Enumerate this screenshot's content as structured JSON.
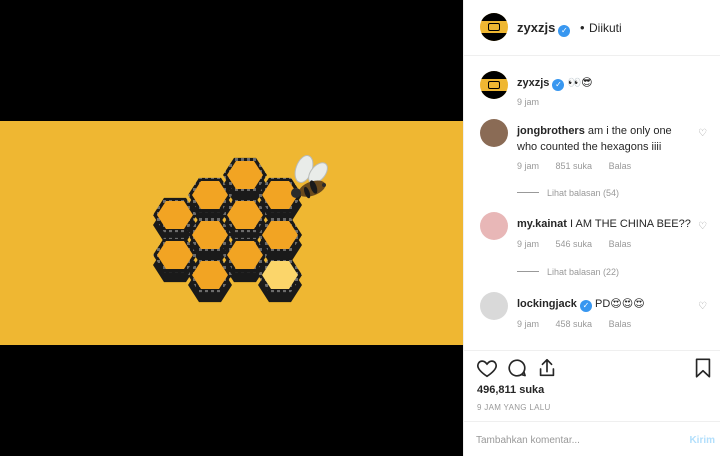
{
  "post": {
    "author": "zyxzjs",
    "follow_status": "Diikuti",
    "dot": "•",
    "caption": "👀😎",
    "caption_time": "9 jam",
    "likes": "496,811 suka",
    "posted": "9 JAM YANG LALU"
  },
  "comments": [
    {
      "user": "jongbrothers",
      "text": "am i the only one who counted the hexagons iiii",
      "time": "9 jam",
      "likes": "851 suka",
      "reply": "Balas",
      "view_replies": "Lihat balasan (54)"
    },
    {
      "user": "my.kainat",
      "text": "I AM THE CHINA BEE??",
      "time": "9 jam",
      "likes": "546 suka",
      "reply": "Balas",
      "view_replies": "Lihat balasan (22)"
    },
    {
      "user": "lockingjack",
      "text": "PD😍😍😍",
      "time": "9 jam",
      "likes": "458 suka",
      "reply": "Balas"
    }
  ],
  "add_comment": {
    "placeholder": "Tambahkan komentar...",
    "post_label": "Kirim"
  },
  "icons": {
    "like": "heart-icon",
    "comment": "comment-bubble-icon",
    "share": "share-icon",
    "save": "bookmark-icon",
    "verified": "verified-badge-icon"
  },
  "colors": {
    "accent": "#3897f0",
    "honey_background": "#efb732",
    "post_button_disabled": "#b2dffc"
  }
}
